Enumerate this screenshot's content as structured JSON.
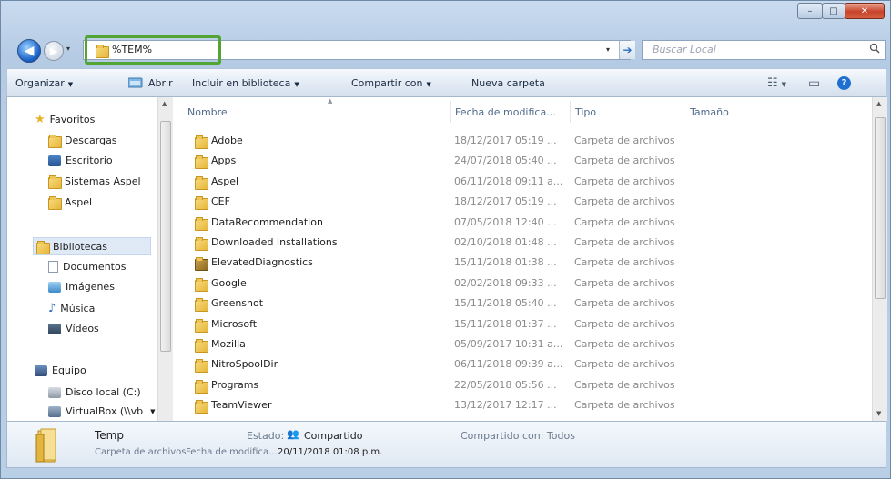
{
  "window": {
    "caption_buttons": {
      "minimize": "–",
      "maximize": "□",
      "close": "✕"
    }
  },
  "nav": {
    "back_icon": "back-arrow-icon",
    "forward_icon": "forward-arrow-icon",
    "history_arrow": "▾",
    "address_value": "%TEM%",
    "address_dropdown": "▾",
    "go_arrow": "➔",
    "search_placeholder": "Buscar Local",
    "search_icon": "⌕"
  },
  "toolbar": {
    "organize": "Organizar",
    "open": "Abrir",
    "include_library": "Incluir en biblioteca",
    "share_with": "Compartir con",
    "new_folder": "Nueva carpeta",
    "view_icon": "☷",
    "preview_icon": "▭",
    "help_icon": "?",
    "dropdown": "▼"
  },
  "sidebar": {
    "favorites": {
      "label": "Favoritos",
      "items": [
        {
          "label": "Descargas"
        },
        {
          "label": "Escritorio"
        },
        {
          "label": "Sistemas Aspel"
        },
        {
          "label": "Aspel"
        }
      ]
    },
    "libraries": {
      "label": "Bibliotecas",
      "items": [
        {
          "label": "Documentos"
        },
        {
          "label": "Imágenes"
        },
        {
          "label": "Música"
        },
        {
          "label": "Vídeos"
        }
      ]
    },
    "computer": {
      "label": "Equipo",
      "items": [
        {
          "label": "Disco local (C:)"
        },
        {
          "label": "VirtualBox (\\\\vb"
        }
      ]
    }
  },
  "columns": {
    "name": "Nombre",
    "date": "Fecha de modifica...",
    "type": "Tipo",
    "size": "Tamaño"
  },
  "files": [
    {
      "name": "Adobe",
      "date": "18/12/2017 05:19 ...",
      "type": "Carpeta de archivos"
    },
    {
      "name": "Apps",
      "date": "24/07/2018 05:40 ...",
      "type": "Carpeta de archivos"
    },
    {
      "name": "Aspel",
      "date": "06/11/2018 09:11 a...",
      "type": "Carpeta de archivos"
    },
    {
      "name": "CEF",
      "date": "18/12/2017 05:19 ...",
      "type": "Carpeta de archivos"
    },
    {
      "name": "DataRecommendation",
      "date": "07/05/2018 12:40 ...",
      "type": "Carpeta de archivos"
    },
    {
      "name": "Downloaded Installations",
      "date": "02/10/2018 01:48 ...",
      "type": "Carpeta de archivos"
    },
    {
      "name": "ElevatedDiagnostics",
      "date": "15/11/2018 01:38 ...",
      "type": "Carpeta de archivos"
    },
    {
      "name": "Google",
      "date": "02/02/2018 09:33 ...",
      "type": "Carpeta de archivos"
    },
    {
      "name": "Greenshot",
      "date": "15/11/2018 05:40 ...",
      "type": "Carpeta de archivos"
    },
    {
      "name": "Microsoft",
      "date": "15/11/2018 01:37 ...",
      "type": "Carpeta de archivos"
    },
    {
      "name": "Mozilla",
      "date": "05/09/2017 10:31 a...",
      "type": "Carpeta de archivos"
    },
    {
      "name": "NitroSpoolDir",
      "date": "06/11/2018 09:39 a...",
      "type": "Carpeta de archivos"
    },
    {
      "name": "Programs",
      "date": "22/05/2018 05:56 ...",
      "type": "Carpeta de archivos"
    },
    {
      "name": "TeamViewer",
      "date": "13/12/2017 12:17 ...",
      "type": "Carpeta de archivos"
    }
  ],
  "details": {
    "name": "Temp",
    "state_label": "Estado:",
    "state_value": "Compartido",
    "shared_with": "Compartido con: Todos",
    "type": "Carpeta de archivos",
    "modified_label": "Fecha de modifica...",
    "modified_value": "20/11/2018 01:08 p.m."
  },
  "colors": {
    "highlight_border": "#52a532",
    "accent": "#1b63c9"
  }
}
